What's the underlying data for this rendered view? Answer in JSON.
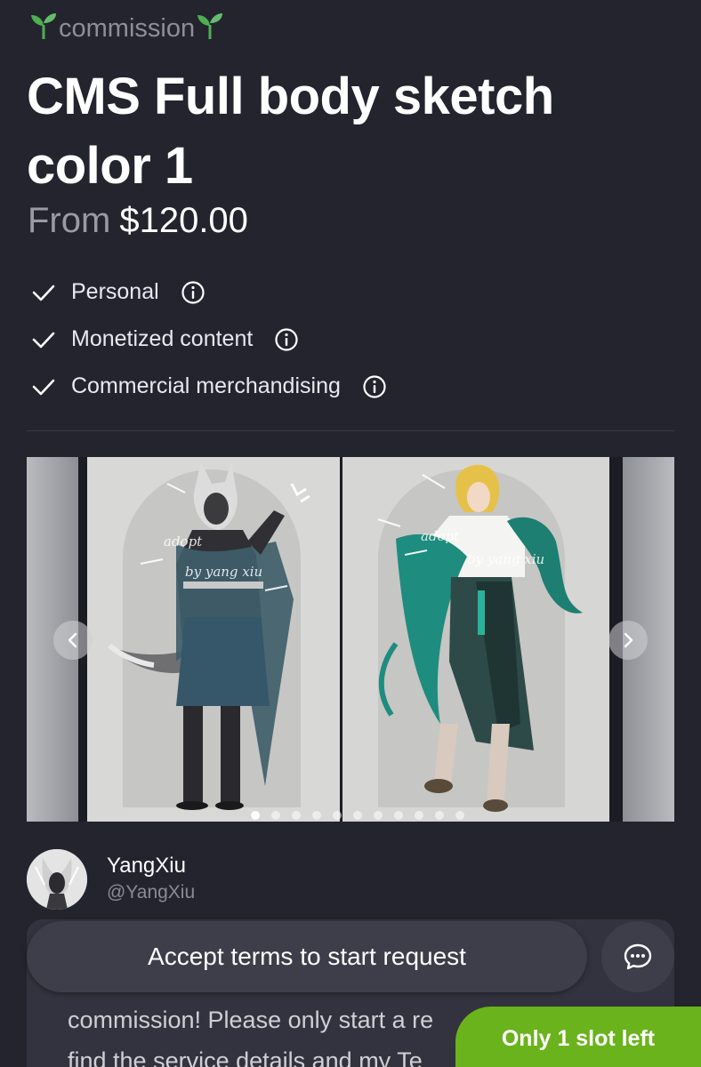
{
  "eyebrow": {
    "label": "commission",
    "icon": "seedling-icon"
  },
  "listing": {
    "title": "CMS Full body sketch color 1",
    "price_prefix": "From",
    "price": "$120.00"
  },
  "usage_rights": [
    {
      "label": "Personal",
      "icon": "check-icon",
      "info_icon": "info-icon"
    },
    {
      "label": "Monetized content",
      "icon": "check-icon",
      "info_icon": "info-icon"
    },
    {
      "label": "Commercial merchandising",
      "icon": "check-icon",
      "info_icon": "info-icon"
    }
  ],
  "gallery": {
    "prev_icon": "chevron-left-icon",
    "next_icon": "chevron-right-icon",
    "dot_count": 11,
    "active_dot": 0,
    "images": [
      {
        "watermark_1": "adopt",
        "watermark_2": "by yang xiu"
      },
      {
        "watermark_1": "adopt",
        "watermark_2": "by yang xiu"
      }
    ]
  },
  "artist": {
    "name": "YangXiu",
    "handle": "@YangXiu"
  },
  "actions": {
    "cta_label": "Accept terms to start request",
    "chat_icon": "chat-bubble-icon"
  },
  "description": {
    "line1": "commission! Please only start a re",
    "line2": "find the service details and my Te"
  },
  "badge": {
    "label": "Only 1 slot left",
    "color": "#6ab31c"
  },
  "colors": {
    "background": "#24242f",
    "accent_green": "#6ab31c"
  }
}
